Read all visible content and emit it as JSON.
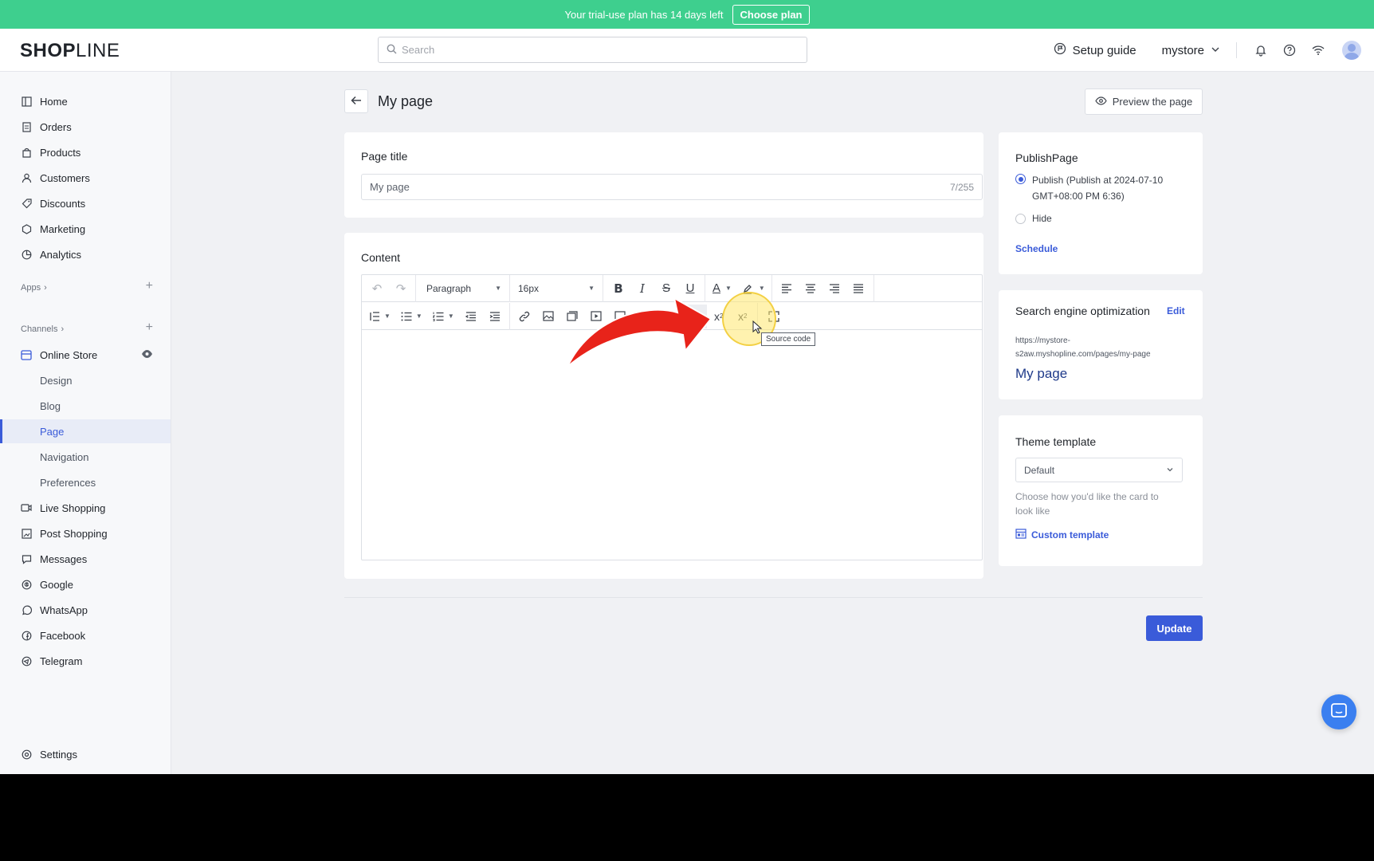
{
  "banner": {
    "text": "Your trial-use plan has 14 days left",
    "button": "Choose plan"
  },
  "header": {
    "logo_bold": "SHOP",
    "logo_light": "LINE",
    "search_placeholder": "Search",
    "setup_guide": "Setup guide",
    "store_name": "mystore"
  },
  "sidebar": {
    "items": [
      {
        "label": "Home",
        "icon": "home-icon"
      },
      {
        "label": "Orders",
        "icon": "orders-icon"
      },
      {
        "label": "Products",
        "icon": "products-icon"
      },
      {
        "label": "Customers",
        "icon": "customers-icon"
      },
      {
        "label": "Discounts",
        "icon": "discounts-icon"
      },
      {
        "label": "Marketing",
        "icon": "marketing-icon"
      },
      {
        "label": "Analytics",
        "icon": "analytics-icon"
      }
    ],
    "apps_label": "Apps",
    "channels_label": "Channels",
    "online_store": "Online Store",
    "store_subitems": [
      "Design",
      "Blog",
      "Page",
      "Navigation",
      "Preferences"
    ],
    "channels": [
      {
        "label": "Live Shopping",
        "icon": "live-shopping-icon"
      },
      {
        "label": "Post Shopping",
        "icon": "post-shopping-icon"
      },
      {
        "label": "Messages",
        "icon": "messages-icon"
      },
      {
        "label": "Google",
        "icon": "google-icon"
      },
      {
        "label": "WhatsApp",
        "icon": "whatsapp-icon"
      },
      {
        "label": "Facebook",
        "icon": "facebook-icon"
      },
      {
        "label": "Telegram",
        "icon": "telegram-icon"
      }
    ],
    "settings": "Settings"
  },
  "main": {
    "page_name": "My page",
    "preview_button": "Preview the page",
    "page_title_label": "Page title",
    "page_title_value": "My page",
    "page_title_count": "7/255",
    "content_label": "Content",
    "toolbar": {
      "paragraph": "Paragraph",
      "font_size": "16px",
      "tooltip": "Source code"
    },
    "update_button": "Update"
  },
  "publish": {
    "title": "PublishPage",
    "publish_label": "Publish",
    "publish_detail": "(Publish at 2024-07-10 GMT+08:00 PM 6:36)",
    "hide_label": "Hide",
    "schedule": "Schedule"
  },
  "seo": {
    "title": "Search engine optimization",
    "edit": "Edit",
    "url_line1": "https://mystore-",
    "url_line2": "s2aw.myshopline.com/pages/my-page",
    "page_title": "My page"
  },
  "theme": {
    "title": "Theme template",
    "selected": "Default",
    "help": "Choose how you'd like the card to look like",
    "custom": "Custom template"
  },
  "colors": {
    "accent": "#3a5bd9",
    "banner": "#3ecf8e",
    "annotation_arrow": "#e8231a"
  }
}
